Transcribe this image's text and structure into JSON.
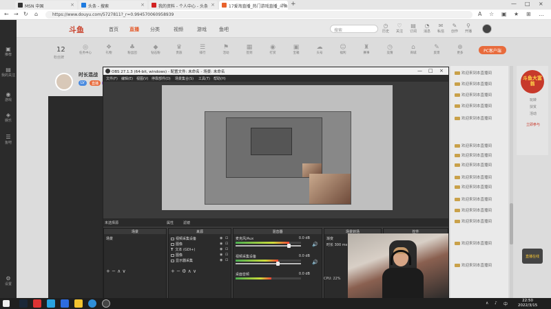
{
  "browser": {
    "tabs": [
      {
        "title": "MSN 中国",
        "color": "#333333",
        "active": false
      },
      {
        "title": "头条 - 搜索",
        "color": "#1e7be0",
        "active": false
      },
      {
        "title": "我的资料 - 个人中心 - 头条",
        "color": "#d22222",
        "active": false
      },
      {
        "title": "17爱淘直播_热门游戏直播_斗鱼",
        "color": "#e8622c",
        "active": true
      }
    ],
    "url": "https://www.douyu.com/5727811?_r=0.994570060958939",
    "new_tab": "+"
  },
  "leftbar": {
    "items": [
      {
        "icon": "▣",
        "label": "推荐"
      },
      {
        "icon": "▤",
        "label": "我的关注"
      },
      {
        "icon": "◉",
        "label": "游戏"
      },
      {
        "icon": "◈",
        "label": "娱乐"
      },
      {
        "icon": "☰",
        "label": "鱼吧"
      }
    ],
    "bottom_item": {
      "icon": "⚙",
      "label": "设置"
    }
  },
  "site": {
    "logo": "斗鱼",
    "nav": [
      "首页",
      "直播",
      "分类",
      "视频",
      "游戏",
      "鱼吧"
    ],
    "active_nav": "直播",
    "search_placeholder": "搜索",
    "header_icons": [
      "历史",
      "关注",
      "订阅",
      "消息",
      "私信",
      "创作",
      "开播"
    ],
    "level_value": "12",
    "level_label": "粉丝牌",
    "tool_icons": [
      "任务中心",
      "礼物",
      "粉丝团",
      "钻石粉",
      "贵族",
      "排行",
      "活动",
      "签到",
      "打赏",
      "宝箱",
      "头号",
      "福利",
      "赛事",
      "竞猜",
      "商城",
      "反馈",
      "更多"
    ],
    "pc_client": "PC客户端"
  },
  "streamer": {
    "name": "时长混战",
    "badges": [
      "LV",
      "直播",
      "高能"
    ]
  },
  "chat": {
    "lines": [
      "欢迎来到本直播间",
      "欢迎来到本直播间",
      "欢迎来到本直播间",
      "欢迎来到本直播间",
      "欢迎来到本直播间",
      "欢迎来到本直播间",
      "欢迎来到本直播间",
      "欢迎来到本直播间",
      "欢迎来到本直播间",
      "欢迎来到本直播间",
      "欢迎来到本直播间",
      "欢迎来到本直播间",
      "欢迎来到本直播间",
      "欢迎来到本直播间",
      "欢迎来到本直播间"
    ]
  },
  "ad": {
    "badge": "斗鱼大富翁",
    "lines": [
      "玩转",
      "扶贫",
      "活动",
      "立即参与"
    ],
    "mini": "直播在线"
  },
  "obs": {
    "title": "OBS 27.1.3 (64-bit, windows) - 配置文件: 未命名 - 场景: 未命名",
    "menu": [
      "文件(F)",
      "编辑(E)",
      "视图(V)",
      "停靠部件(D)",
      "场景集合(S)",
      "工具(T)",
      "帮助(H)"
    ],
    "scenebar_label": "未选择源",
    "scenebar_buttons": [
      "属性",
      "滤镜"
    ],
    "docks": {
      "scenes": {
        "title": "场景",
        "items": [
          "场景"
        ]
      },
      "sources": {
        "title": "来源",
        "items": [
          "视频采集设备",
          "图像",
          "文本 (GDI+)",
          "图像",
          "显示器采集"
        ]
      },
      "mixer": {
        "title": "混音器",
        "channels": [
          {
            "name": "麦克风/Aux",
            "db": "0.0 dB",
            "level": 0.82
          },
          {
            "name": "视频采集设备",
            "db": "0.0 dB",
            "level": 0.65
          },
          {
            "name": "桌面音频",
            "db": "0.0 dB",
            "level": 0.55
          }
        ]
      },
      "transitions": {
        "title": "场景转场",
        "fade": "渐变",
        "duration_label": "时长",
        "duration": "300 ms"
      },
      "controls": {
        "title": "控件"
      }
    },
    "status": [
      "CPU: 22%",
      "LIVE: 00:00:00",
      "REC: 00:00:00"
    ]
  },
  "taskbar": {
    "time": "22:50",
    "date": "2022/3/15",
    "tray": [
      "∧",
      "♪",
      "中"
    ]
  }
}
